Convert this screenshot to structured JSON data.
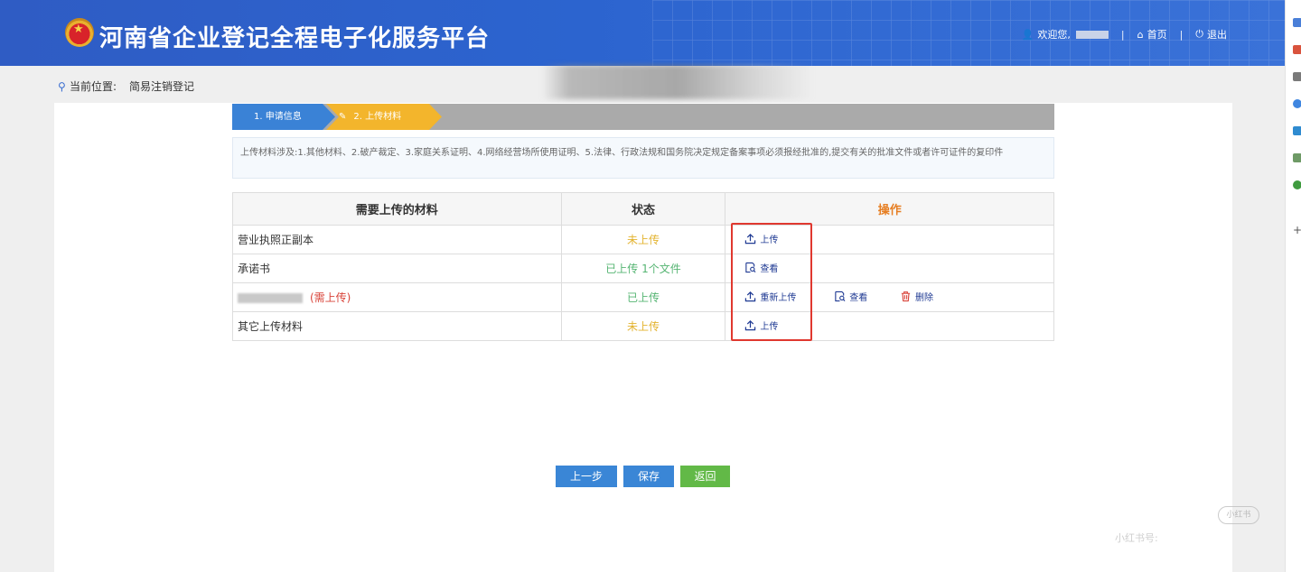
{
  "header": {
    "title": "河南省企业登记全程电子化服务平台",
    "welcome": "欢迎您,",
    "home": "首页",
    "logout": "退出",
    "separator": "|"
  },
  "breadcrumb": {
    "label": "当前位置:",
    "value": "简易注销登记"
  },
  "steps": [
    {
      "label": "1. 申请信息",
      "active": false
    },
    {
      "label": "2. 上传材料",
      "active": true
    }
  ],
  "notice": "上传材料涉及:1.其他材料、2.破产裁定、3.家庭关系证明、4.网络经营场所使用证明、5.法律、行政法规和国务院决定规定备案事项必须报经批准的,提交有关的批准文件或者许可证件的复印件",
  "table": {
    "headers": [
      "需要上传的材料",
      "状态",
      "操作"
    ],
    "rows": [
      {
        "name": "营业执照正副本",
        "required": "",
        "status": "未上传",
        "actions": [
          "上传"
        ]
      },
      {
        "name": "承诺书",
        "required": "",
        "status": "已上传 1个文件",
        "actions": [
          "查看"
        ]
      },
      {
        "name": "",
        "required": "(需上传)",
        "status": "已上传",
        "actions": [
          "重新上传",
          "查看",
          "删除"
        ]
      },
      {
        "name": "其它上传材料",
        "required": "",
        "status": "未上传",
        "actions": [
          "上传"
        ]
      }
    ]
  },
  "buttons": {
    "prev": "上一步",
    "save": "保存",
    "back": "返回"
  },
  "watermark": {
    "logo": "小红书",
    "id": "小红书号:"
  },
  "colors": {
    "header_blue": "#2c64cf",
    "step_active": "#f3b52c",
    "step_done": "#3a82d6",
    "pending": "#e3b32f",
    "done": "#56b573",
    "required": "#d9443a",
    "back_button": "#62b947"
  }
}
